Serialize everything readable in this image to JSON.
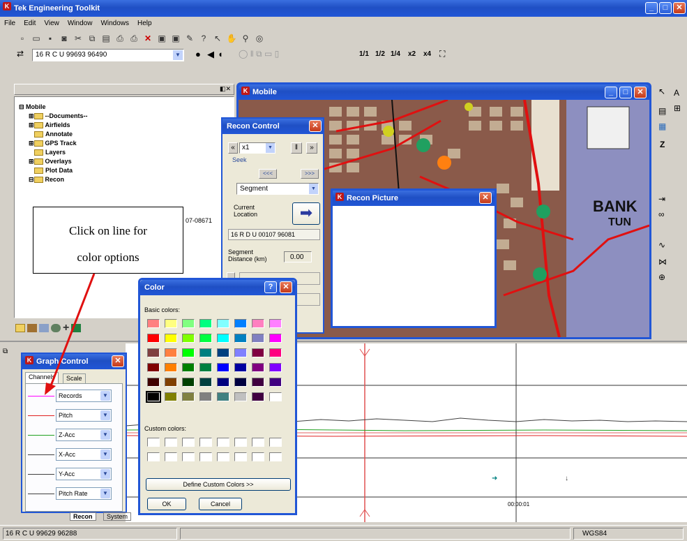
{
  "app": {
    "title": "Tek Engineering Toolkit"
  },
  "menu": [
    "File",
    "Edit",
    "View",
    "Window",
    "Windows",
    "Help"
  ],
  "toolbar": {
    "coords": "16 R C U 99693 96490",
    "zoom_labels": [
      "1/1",
      "1/2",
      "1/4",
      "x2",
      "x4"
    ]
  },
  "tree": {
    "root": "Mobile",
    "items": [
      "--Documents--",
      "Airfields",
      "Annotate",
      "GPS Track",
      "Layers",
      "Overlays",
      "Plot Data",
      "Recon"
    ],
    "partial_text": "07-08671"
  },
  "mobile_window": {
    "title": "Mobile"
  },
  "map": {
    "label": "BANK\nTUN"
  },
  "recon_control": {
    "title": "Recon Control",
    "speed": "x1",
    "seek_label": "Seek",
    "mode": "Segment",
    "current_location_label": "Current Location",
    "location_value": "16 R D U 00107 96081",
    "segment_distance_label": "Segment Distance (km)",
    "segment_distance_value": "0.00"
  },
  "recon_picture": {
    "title": "Recon Picture"
  },
  "color_dialog": {
    "title": "Color",
    "basic_colors_label": "Basic colors:",
    "custom_colors_label": "Custom colors:",
    "define_button": "Define Custom Colors >>",
    "ok": "OK",
    "cancel": "Cancel",
    "basic_colors": [
      "#ff8080",
      "#ffff80",
      "#80ff80",
      "#00ff80",
      "#80ffff",
      "#0080ff",
      "#ff80c0",
      "#ff80ff",
      "#ff0000",
      "#ffff00",
      "#80ff00",
      "#00ff40",
      "#00ffff",
      "#0080c0",
      "#8080c0",
      "#ff00ff",
      "#804040",
      "#ff8040",
      "#00ff00",
      "#008080",
      "#004080",
      "#8080ff",
      "#800040",
      "#ff0080",
      "#800000",
      "#ff8000",
      "#008000",
      "#008040",
      "#0000ff",
      "#0000a0",
      "#800080",
      "#8000ff",
      "#400000",
      "#804000",
      "#004000",
      "#004040",
      "#000080",
      "#000040",
      "#400040",
      "#400080",
      "#000000",
      "#808000",
      "#808040",
      "#808080",
      "#408080",
      "#c0c0c0",
      "#400040",
      "#ffffff"
    ]
  },
  "callout": {
    "line1": "Click on line for",
    "line2": "color options"
  },
  "graph_control": {
    "title": "Graph Control",
    "tabs": [
      "Channels",
      "Scale"
    ],
    "channels": [
      {
        "name": "Records",
        "color": "#ff00ff"
      },
      {
        "name": "Pitch",
        "color": "#e02020"
      },
      {
        "name": "Z-Acc",
        "color": "#20a020"
      },
      {
        "name": "X-Acc",
        "color": "#404040"
      },
      {
        "name": "Y-Acc",
        "color": "#404040"
      },
      {
        "name": "Pitch Rate",
        "color": "#404040"
      }
    ]
  },
  "graph": {
    "time_label": "00:00:01"
  },
  "bottom_tabs": [
    "Recon",
    "System"
  ],
  "status": {
    "coords": "16 R C U 99629 96288",
    "datum": "WGS84"
  }
}
